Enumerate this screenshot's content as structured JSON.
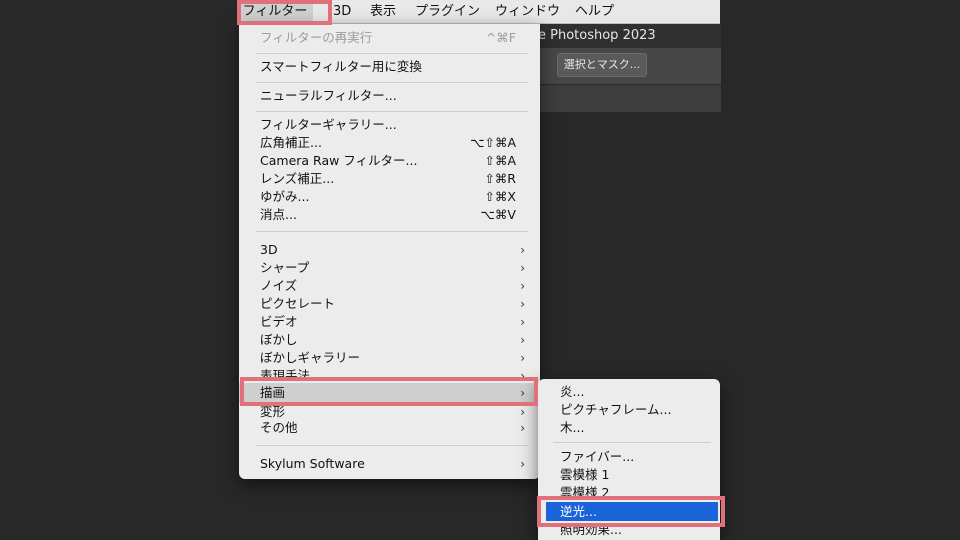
{
  "menubar": {
    "items": [
      "フィルター",
      "3D",
      "表示",
      "プラグイン",
      "ウィンドウ",
      "ヘルプ"
    ]
  },
  "app": {
    "title": "e Photoshop 2023",
    "select_mask_button": "選択とマスク..."
  },
  "filter_menu": {
    "items": [
      {
        "label": "フィルターの再実行",
        "shortcut": "^⌘F"
      },
      {
        "label": "スマートフィルター用に変換"
      },
      {
        "label": "ニューラルフィルター..."
      },
      {
        "label": "フィルターギャラリー..."
      },
      {
        "label": "広角補正...",
        "shortcut": "⌥⇧⌘A"
      },
      {
        "label": "Camera Raw フィルター...",
        "shortcut": "⇧⌘A"
      },
      {
        "label": "レンズ補正...",
        "shortcut": "⇧⌘R"
      },
      {
        "label": "ゆがみ...",
        "shortcut": "⇧⌘X"
      },
      {
        "label": "消点...",
        "shortcut": "⌥⌘V"
      },
      {
        "label": "3D",
        "arrow": "›"
      },
      {
        "label": "シャープ",
        "arrow": "›"
      },
      {
        "label": "ノイズ",
        "arrow": "›"
      },
      {
        "label": "ピクセレート",
        "arrow": "›"
      },
      {
        "label": "ビデオ",
        "arrow": "›"
      },
      {
        "label": "ぼかし",
        "arrow": "›"
      },
      {
        "label": "ぼかしギャラリー",
        "arrow": "›"
      },
      {
        "label": "表現手法",
        "arrow": "›"
      },
      {
        "label": "描画",
        "arrow": "›"
      },
      {
        "label": "変形",
        "arrow": "›"
      },
      {
        "label": "その他",
        "arrow": "›"
      },
      {
        "label": "Skylum Software",
        "arrow": "›"
      }
    ]
  },
  "render_submenu": {
    "items": [
      {
        "label": "炎..."
      },
      {
        "label": "ピクチャフレーム..."
      },
      {
        "label": "木..."
      },
      {
        "label": "ファイバー..."
      },
      {
        "label": "雲模様 1"
      },
      {
        "label": "雲模様 2"
      },
      {
        "label": "逆光..."
      },
      {
        "label": "照明効果..."
      }
    ]
  },
  "colors": {
    "background": "#282828",
    "menu_bg": "#ececec",
    "selection": "#1a64d9",
    "highlight_box": "#e0707a"
  }
}
